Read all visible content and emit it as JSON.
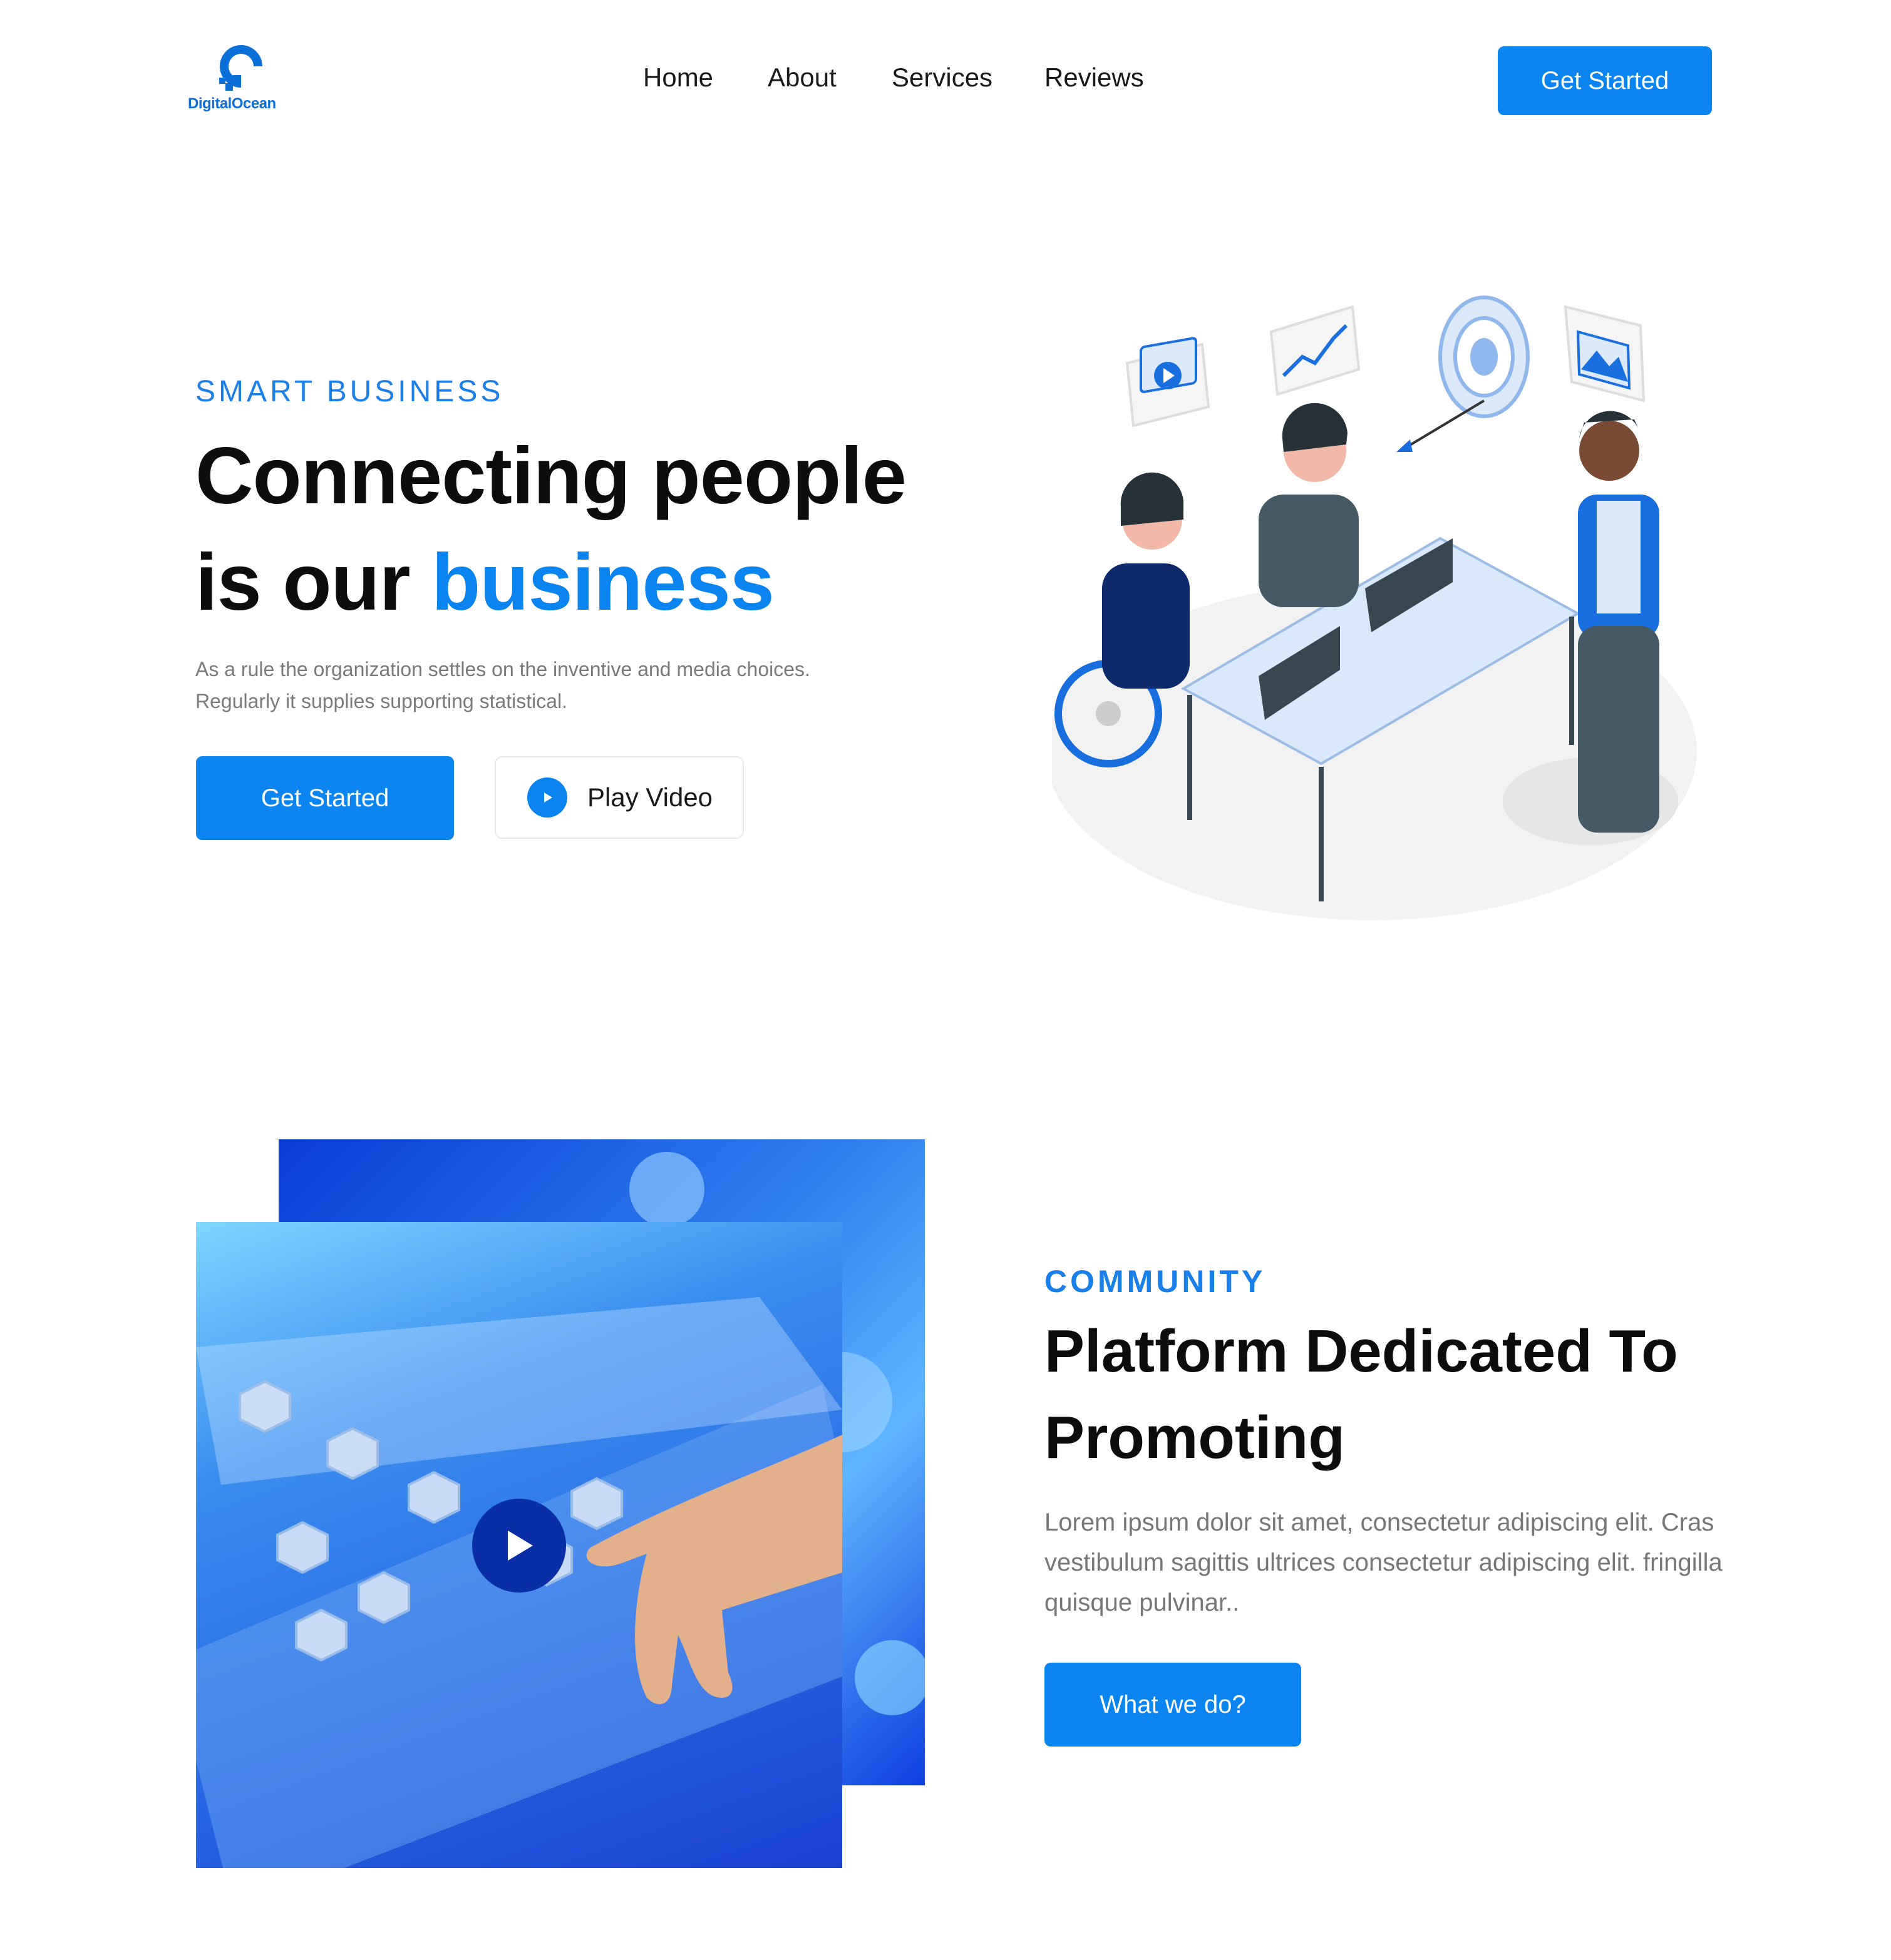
{
  "header": {
    "logo_text": "DigitalOcean",
    "nav": [
      "Home",
      "About",
      "Services",
      "Reviews"
    ],
    "cta_label": "Get Started"
  },
  "hero": {
    "eyebrow": "SMART BUSINESS",
    "title_line1": "Connecting people",
    "title_line2_prefix": "is our ",
    "title_line2_highlight": "business",
    "description": "As a rule the organization settles on the inventive and media choices. Regularly it supplies supporting statistical.",
    "primary_cta": "Get Started",
    "secondary_cta": "Play Video",
    "illustration_icon": "team-meeting-illustration"
  },
  "community": {
    "eyebrow": "COMMUNITY",
    "title": "Platform Dedicated To Promoting",
    "description": "Lorem ipsum dolor sit amet, consectetur adipiscing elit. Cras vestibulum sagittis ultrices consectetur adipiscing elit. fringilla quisque pulvinar..",
    "cta_label": "What we do?",
    "image_icon": "tech-hand-image"
  },
  "colors": {
    "accent": "#0a84f0",
    "text_dark": "#0d0d0d",
    "text_muted": "#7a7a7a"
  }
}
